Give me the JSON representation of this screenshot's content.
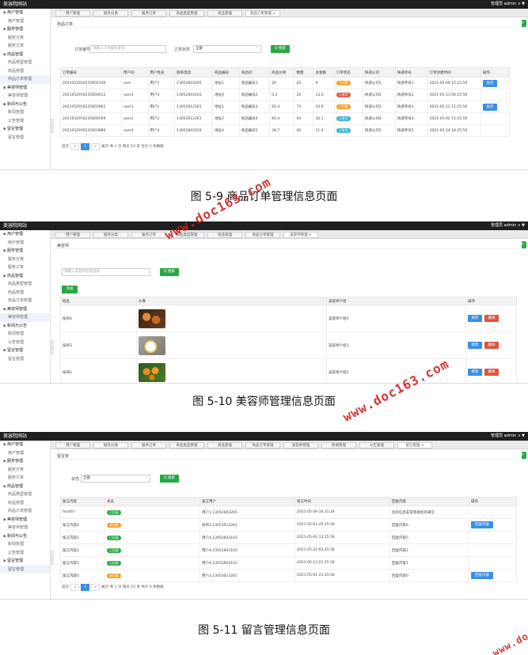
{
  "figure1": {
    "caption": "图 5-9 商品订单管理信息页面",
    "app_title": "美容院网站",
    "user": "管理员  admin ∨  ▼",
    "sidebar": [
      "用户管理",
      "用户管理",
      "服务管理",
      "服务分类",
      "服务订单",
      "商品管理",
      "商品类型管理",
      "商品管理",
      "商品订单管理",
      "美容师管理",
      "美容师管理",
      "新闻与公告",
      "新闻管理",
      "公告管理",
      "留言管理",
      "留言管理"
    ],
    "tabs": [
      "用户管理",
      "服务分类",
      "服务订单",
      "商品类型管理",
      "商品管理",
      "商品订单管理"
    ],
    "panel_title": "商品订单",
    "filter_label1": "订单编号",
    "filter_placeholder1": "请输入订单编号查询",
    "filter_label2": "订单状态",
    "filter_value2": "全部",
    "search_label": "Q 搜索",
    "columns": [
      "订单编号",
      "用户ID",
      "用户姓名",
      "联系电话",
      "商品编号",
      "商品ID",
      "商品价格",
      "数量",
      "总金额",
      "订单状态",
      "快递公司",
      "快递单号",
      "订单创建时间",
      "操作"
    ],
    "rows": [
      [
        "2021052916235602100",
        "user",
        "用户1",
        "13052603265",
        "地址1",
        "商品编号1",
        "20",
        "20",
        "9",
        "已付款",
        "快递公司1",
        "快递单号1",
        "2021-05-09 15:25:56",
        "发货"
      ],
      [
        "2021052916235604012",
        "user4",
        "用户4",
        "13052603103",
        "地址4",
        "商品编号2",
        "0.3",
        "20",
        "13.0",
        "已收货",
        "快递公司2",
        "快递单号2",
        "2021-05-11 06:25:56",
        ""
      ],
      [
        "2021052916235602861",
        "user1",
        "用户1",
        "13052612261",
        "地址1",
        "商品编号3",
        "60.4",
        "72",
        "10.6",
        "已付款",
        "快递公司3",
        "快递单号3",
        "2021-05-12 11:25:56",
        "发货"
      ],
      [
        "2021052916235604569",
        "user2",
        "用户2",
        "13052612261",
        "地址2",
        "商品编号4",
        "60.4",
        "04",
        "30.1",
        "已发货",
        "快递公司4",
        "快递单号4",
        "2021-05-02 15:25:56",
        ""
      ],
      [
        "2021052916235603980",
        "user4",
        "用户4",
        "13052603103",
        "地址4",
        "商品编号5",
        "38.7",
        "40",
        "21.4",
        "已发货",
        "快递公司5",
        "快递单号5",
        "2021-05-24 18:25:56",
        ""
      ]
    ],
    "pager": {
      "prev": "首页",
      "first": "«",
      "cur": "1",
      "next": "»",
      "last": "尾页",
      "info": "共 1 页  每页 10 条  合计 5 条数据"
    }
  },
  "figure2": {
    "caption": "图 5-10 美容师管理信息页面",
    "tabs": [
      "用户管理",
      "服务分类",
      "服务订单",
      "商品类型管理",
      "商品管理",
      "商品订单管理",
      "美容师管理"
    ],
    "panel_title": "美容师",
    "filter_placeholder": "请输入美容师名称查询",
    "search_label": "Q 搜索",
    "add_label": "添加",
    "columns": [
      "姓名",
      "头像",
      "美容师介绍",
      "操作"
    ],
    "rows": [
      [
        "技师4",
        "美容师介绍4"
      ],
      [
        "技师3",
        "美容师介绍3"
      ],
      [
        "技师2",
        "美容师介绍2"
      ]
    ],
    "edit_label": "修改",
    "delete_label": "删除"
  },
  "figure3": {
    "caption": "图 5-11 留言管理信息页面",
    "tabs": [
      "用户管理",
      "服务分类",
      "服务订单",
      "商品类型管理",
      "商品管理",
      "商品订单管理",
      "美容师管理",
      "新闻管理",
      "公告管理",
      "留言管理"
    ],
    "panel_title": "留言管",
    "filter_label": "状态",
    "filter_value": "全部",
    "search_label": "Q 搜索",
    "columns": [
      "留言内容",
      "状态",
      "留言用户",
      "留言时间",
      "回复内容",
      "操作"
    ],
    "rows": [
      [
        "fasdfsf",
        "已回复",
        "用户1,13052603265",
        "2021-05-29 16:31:24",
        "您的信息非常感谢您的来信",
        ""
      ],
      [
        "留言内容6",
        "未回复",
        "技师1,13053013261",
        "2021-05-03 20:25:56",
        "回复内容6",
        "回复内容"
      ],
      [
        "留言内容5",
        "已回复",
        "用户4,13052603103",
        "2021-05-01 13:25:56",
        "回复内容5",
        ""
      ],
      [
        "留言内容2",
        "已回复",
        "用户4,13052603103",
        "2021-05-22 05:25:56",
        "回复内容2",
        ""
      ],
      [
        "留言内容1",
        "已回复",
        "用户4,13052603103",
        "2021-05-13 01:25:56",
        "回复内容1",
        ""
      ],
      [
        "留言内容0",
        "未回复",
        "用户2,13053013265",
        "2021-05-01 21:25:56",
        "回复内容0",
        "回复内容"
      ]
    ],
    "pager": {
      "prev": "首页",
      "first": "«",
      "cur": "1",
      "next": "»",
      "last": "尾页",
      "info": "共 1 页  每页 10 条  共计 6 条数据"
    }
  },
  "watermark_text": "www.doc163.com",
  "colors": {
    "green": "#27a845",
    "blue": "#3a8ee6",
    "red": "#e0533f",
    "orange": "#f0a020",
    "teal": "#3bb0d0"
  }
}
